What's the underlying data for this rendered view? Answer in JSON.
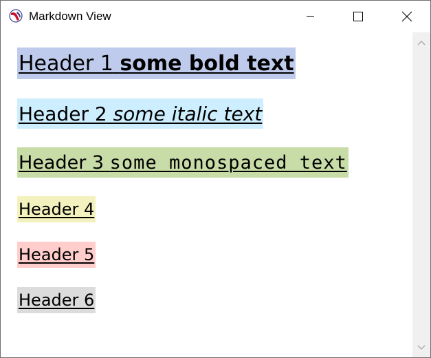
{
  "window": {
    "title": "Markdown View",
    "icon": "racket-logo-icon",
    "controls": [
      "minimize-icon",
      "maximize-icon",
      "close-icon"
    ]
  },
  "headings": [
    {
      "text": "Header 1",
      "styled_text": "some bold text",
      "style": "bold",
      "background": "#bfcbec"
    },
    {
      "text": "Header 2",
      "styled_text": "some italic text",
      "style": "italic",
      "background": "#cdeefe"
    },
    {
      "text": "Header 3",
      "styled_text": "some monospaced text",
      "style": "monospace",
      "background": "#c8dca8"
    },
    {
      "text": "Header 4",
      "background": "#f3f1bd"
    },
    {
      "text": "Header 5",
      "background": "#ffcdcb"
    },
    {
      "text": "Header 6",
      "background": "#dcdcdc"
    }
  ],
  "scrollbar": {
    "up_icon": "chevron-up-icon",
    "down_icon": "chevron-down-icon"
  }
}
